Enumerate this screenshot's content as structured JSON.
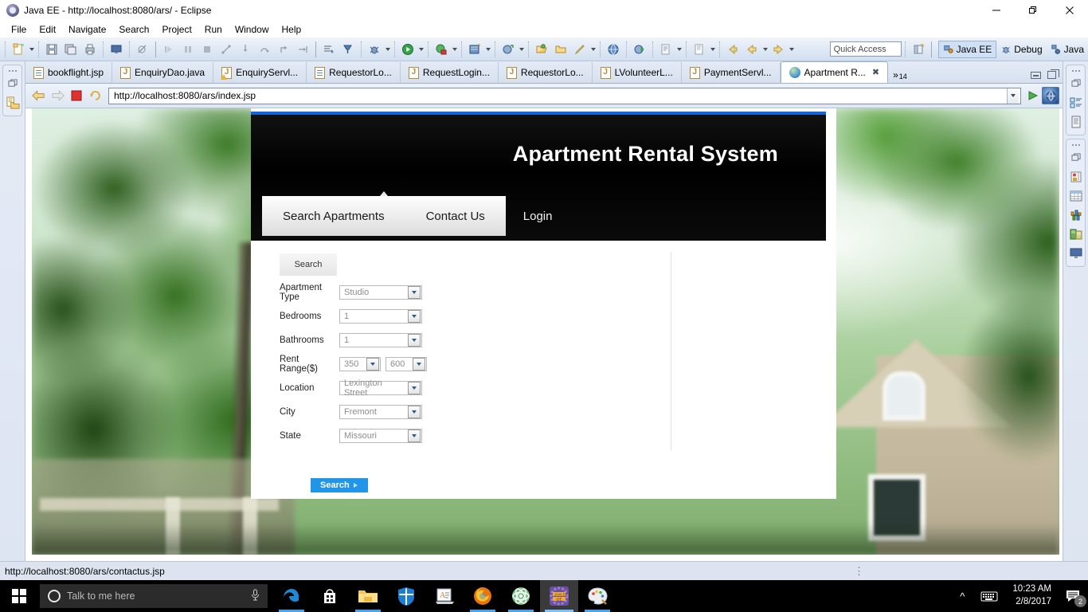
{
  "window": {
    "title": "Java EE - http://localhost:8080/ars/ - Eclipse",
    "app_icon": "eclipse-icon",
    "minimize": "—",
    "maximize": "❐",
    "close": "✕"
  },
  "menu": {
    "items": [
      "File",
      "Edit",
      "Navigate",
      "Search",
      "Project",
      "Run",
      "Window",
      "Help"
    ]
  },
  "toolbar": {
    "quick_access_placeholder": "Quick Access",
    "perspectives": [
      {
        "label": "Java EE",
        "icon": "javaee-perspective-icon",
        "active": true
      },
      {
        "label": "Debug",
        "icon": "debug-perspective-icon",
        "active": false
      },
      {
        "label": "Java",
        "icon": "java-perspective-icon",
        "active": false
      }
    ]
  },
  "editor_tabs": {
    "items": [
      {
        "label": "bookflight.jsp",
        "icon": "jsp-file-icon",
        "active": false,
        "warning": false
      },
      {
        "label": "EnquiryDao.java",
        "icon": "java-file-icon",
        "active": false,
        "warning": false
      },
      {
        "label": "EnquiryServl...",
        "icon": "java-file-icon",
        "active": false,
        "warning": true
      },
      {
        "label": "RequestorLo...",
        "icon": "jsp-file-icon",
        "active": false,
        "warning": false
      },
      {
        "label": "RequestLogin...",
        "icon": "java-file-icon",
        "active": false,
        "warning": false
      },
      {
        "label": "RequestorLo...",
        "icon": "java-file-icon",
        "active": false,
        "warning": false
      },
      {
        "label": "LVolunteerL...",
        "icon": "java-file-icon",
        "active": false,
        "warning": false
      },
      {
        "label": "PaymentServl...",
        "icon": "java-file-icon",
        "active": false,
        "warning": false
      },
      {
        "label": "Apartment R...",
        "icon": "browser-globe-icon",
        "active": true,
        "warning": false
      }
    ],
    "overflow_symbol": "»",
    "overflow_count": "14",
    "close_symbol": "✖"
  },
  "browser": {
    "back_icon": "back-arrow-icon",
    "forward_icon": "forward-arrow-icon",
    "stop_icon": "stop-icon",
    "refresh_icon": "refresh-icon",
    "url": "http://localhost:8080/ars/index.jsp",
    "go_icon": "run-icon",
    "open_external_icon": "open-in-browser-icon"
  },
  "page": {
    "title": "Apartment Rental System",
    "nav": [
      {
        "label": "Search Apartments",
        "active": true
      },
      {
        "label": "Contact Us",
        "active": true
      },
      {
        "label": "Login",
        "active": false
      }
    ],
    "form": {
      "panel_heading": "Search",
      "fields": [
        {
          "label": "Apartment Type",
          "value": "Studio",
          "name": "apartment-type"
        },
        {
          "label": "Bedrooms",
          "value": "1",
          "name": "bedrooms"
        },
        {
          "label": "Bathrooms",
          "value": "1",
          "name": "bathrooms"
        },
        {
          "label": "Location",
          "value": "Lexington Street",
          "name": "location"
        },
        {
          "label": "City",
          "value": "Fremont",
          "name": "city"
        },
        {
          "label": "State",
          "value": "Missouri",
          "name": "state"
        }
      ],
      "rent_range": {
        "label": "Rent Range($)",
        "min": "350",
        "max": "600"
      },
      "submit_label": "Search"
    },
    "accent_color": "#1565d8",
    "button_color": "#2196e8"
  },
  "status_bar": {
    "text": "http://localhost:8080/ars/contactus.jsp",
    "resize_grip": "⋮"
  },
  "taskbar": {
    "start_icon": "windows-start-icon",
    "cortana_placeholder": "Talk to me here",
    "mic_icon": "microphone-icon",
    "apps": [
      {
        "name": "edge-icon",
        "label": "Microsoft Edge",
        "state": "running"
      },
      {
        "name": "store-icon",
        "label": "Microsoft Store",
        "state": "idle"
      },
      {
        "name": "file-explorer-icon",
        "label": "File Explorer",
        "state": "running"
      },
      {
        "name": "windows-defender-icon",
        "label": "Windows Defender",
        "state": "idle"
      },
      {
        "name": "text-editor-icon",
        "label": "Editor",
        "state": "idle"
      },
      {
        "name": "firefox-icon",
        "label": "Mozilla Firefox",
        "state": "running"
      },
      {
        "name": "atom-icon",
        "label": "Atom",
        "state": "running"
      },
      {
        "name": "java-ee-ide-icon",
        "label": "Java EE IDE",
        "state": "active"
      },
      {
        "name": "paint-icon",
        "label": "Paint",
        "state": "running"
      }
    ],
    "show_hidden_icon": "chevron-up-icon",
    "keyboard_icon": "keyboard-icon",
    "clock_time": "10:23 AM",
    "clock_date": "2/8/2017",
    "notification_icon": "action-center-icon",
    "notification_count": "2"
  }
}
